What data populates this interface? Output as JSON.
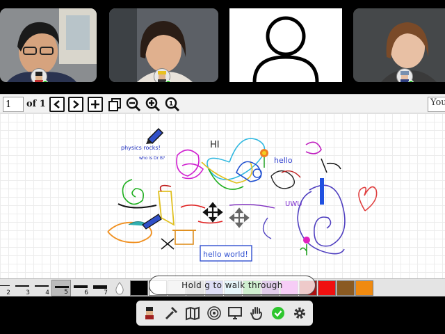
{
  "pager": {
    "current_page": "1",
    "of_label": "of 1",
    "search_placeholder": "You"
  },
  "board": {
    "texts": {
      "hi": "HI",
      "physics": "physics rocks!",
      "physics2": "who is Dr B?",
      "hello": "hello",
      "uwu": "UWU",
      "hello_world": "hello world!"
    }
  },
  "walk_hint": "Hold g to walk through",
  "stroke_sizes": [
    "2",
    "3",
    "4",
    "5",
    "6",
    "7"
  ],
  "selected_stroke": "5",
  "colors": {
    "accent_green": "#2ec62e",
    "palette": [
      "#000000",
      "#ffffff",
      "#cfcfcf",
      "#8a8a8a",
      "#6b6bd6",
      "#8ed6e8",
      "#28b828",
      "#7a1fa3",
      "#d61fd6",
      "#b01010",
      "#f01010",
      "#8a5a22",
      "#f08a10"
    ]
  }
}
